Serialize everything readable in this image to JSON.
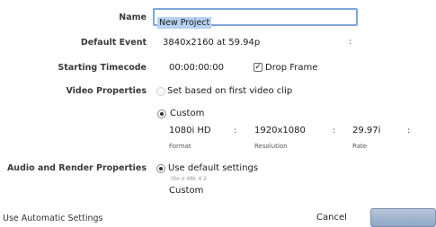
{
  "labels": {
    "name": "Name",
    "default_event": "Default Event",
    "starting_timecode": "Starting Timecode",
    "video_properties": "Video Properties",
    "audio_render": "Audio and Render Properties"
  },
  "name_field": {
    "value": "New Project"
  },
  "default_event": {
    "value": "3840x2160 at 59.94p",
    "arrow": ":"
  },
  "timecode": {
    "value": "00:00:00:00",
    "drop_frame_label": "Drop Frame",
    "drop_frame_checked": true
  },
  "video": {
    "set_based_label": "Set based on first video clip",
    "custom_label": "Custom",
    "selected": "custom",
    "format": {
      "value": "1080i HD",
      "caption": "Format",
      "sep": ":"
    },
    "resolution": {
      "value": "1920x1080",
      "caption": "Resolution",
      "sep": ":"
    },
    "rate": {
      "value": "29.97i",
      "caption": "Rate",
      "sep": ":"
    }
  },
  "audio": {
    "use_default_label": "Use default settings",
    "detail": "Ste o 48k 4 2",
    "custom_label": "Custom",
    "selected": "default"
  },
  "footer": {
    "auto_settings_label": "Use Automatic Settings",
    "cancel_label": "Cancel"
  },
  "colors": {
    "input_border": "#7ea6d8",
    "selection": "#b7d2f2",
    "primary_button": "#8ea4c2"
  },
  "icons": {
    "checkmark": "✓"
  }
}
